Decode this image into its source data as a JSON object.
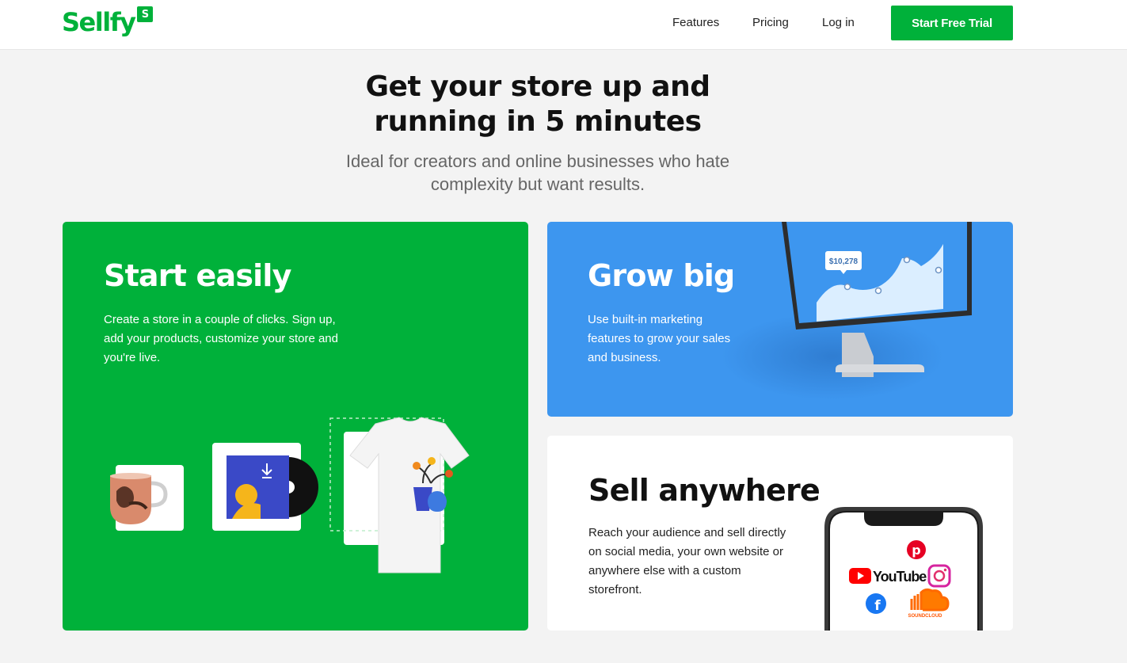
{
  "header": {
    "logo_text": "Sellfy",
    "logo_badge": "S",
    "nav": {
      "features": "Features",
      "pricing": "Pricing",
      "login": "Log in"
    },
    "cta_label": "Start Free Trial"
  },
  "hero": {
    "title_line1": "Get your store up and",
    "title_line2": "running in 5 minutes",
    "subtitle_line1": "Ideal for creators and online businesses who hate",
    "subtitle_line2": "complexity but want results."
  },
  "cards": {
    "start": {
      "title": "Start easily",
      "text": "Create a store in a couple of clicks. Sign up, add your products, customize your store and you're live."
    },
    "grow": {
      "title": "Grow big",
      "text": "Use built-in marketing features to grow your sales and business.",
      "chart_value": "$10,278"
    },
    "sell": {
      "title": "Sell anywhere",
      "text": "Reach your audience and sell directly on social media, your own website or anywhere else with a custom storefront.",
      "social": {
        "youtube": "YouTube",
        "soundcloud": "SOUNDCLOUD"
      }
    }
  },
  "colors": {
    "brand_green": "#00b13a",
    "blue": "#3d96ef"
  }
}
